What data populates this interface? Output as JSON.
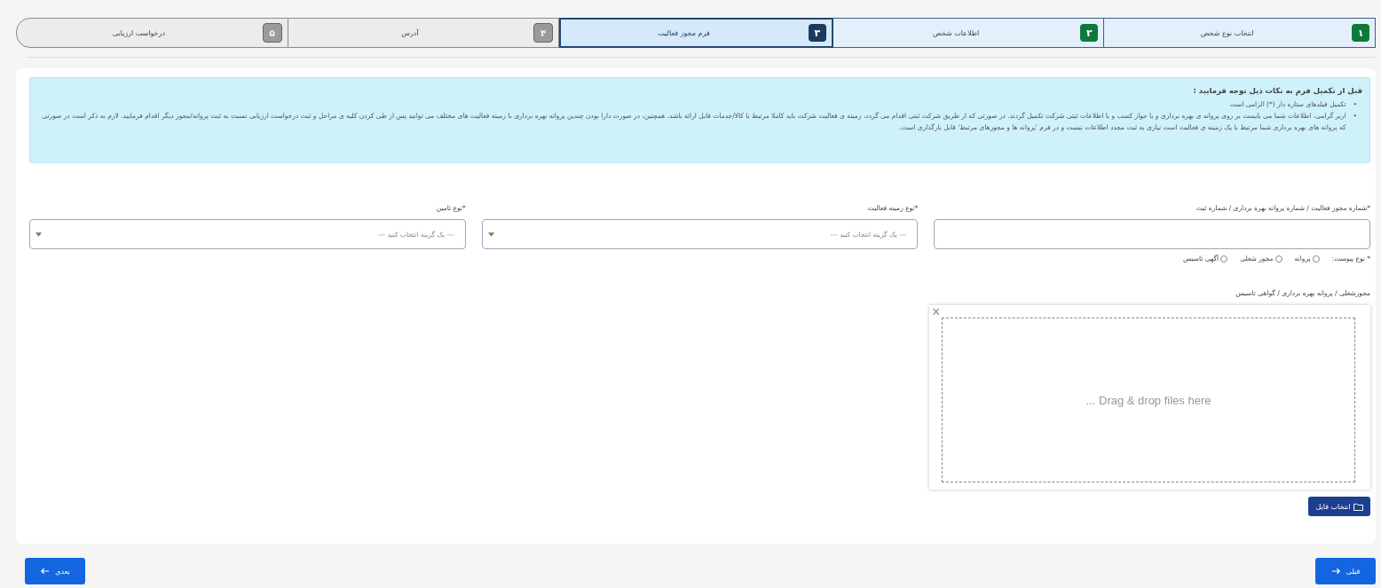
{
  "steps": [
    {
      "number": "۱",
      "label": "انتخاب نوع شخص",
      "completed": true,
      "selected": false
    },
    {
      "number": "۲",
      "label": "اطلاعات شخص",
      "completed": true,
      "selected": false
    },
    {
      "number": "۳",
      "label": "فرم مجوز فعالیت",
      "completed": false,
      "selected": true
    },
    {
      "number": "۴",
      "label": "آدرس",
      "completed": false,
      "selected": false
    },
    {
      "number": "۵",
      "label": "درخواست ارزیابی",
      "completed": false,
      "selected": false
    }
  ],
  "notice": {
    "title": "قبل از تکمیل فرم به نکات ذیل توجه فرمایید :",
    "items": [
      {
        "bullet": "•",
        "text": "تکمیل فیلدهای ستاره دار (*) الزامی است"
      },
      {
        "bullet": "•",
        "text": "اربر گرامی، اطلاعات شما می بایست بر روی پروانه ی بهره برداری و یا جواز کسب و با اطلاعات ثبتی شرکت تکمیل گردند. در صورتی که از طریق شرکت ثبتی اقدام می گردد، زمینه ی فعالیت شرکت باید کاملا مرتبط با کالا/خدمات قابل ارائه باشد. همچنین، در صورت دارا بودن چندین پروانه بهره برداری با زمینه فعالیت های مختلف می توانید پس از طی کردن کلیه ی مراحل و ثبت درخواست ارزیابی نسبت به ثبت پروانه/مجوز دیگر اقدام فرمایید. لازم به ذکر است در صورتی که پروانه های بهره برداری شما مرتبط با یک زمینه ی فعالیت است نیازی به ثبت مجدد اطلاعات نیست و در فرم 'پروانه ها و مجوزهای مرتبط' قابل بارگذاری است."
      }
    ]
  },
  "fields": [
    {
      "kind": "text",
      "label": "*شماره مجوز فعالیت / شماره پروانه بهره برداری / شماره ثبت"
    },
    {
      "kind": "select",
      "label": "*نوع زمینه فعالیت",
      "placeholder": "--- یک گزینه انتخاب کنید ---"
    },
    {
      "kind": "select",
      "label": "*نوع تامین",
      "placeholder": "--- یک گزینه انتخاب کنید ---"
    }
  ],
  "attachment_type": {
    "label": "* نوع پیوست:",
    "options": [
      {
        "label": "پروانه",
        "selected": false
      },
      {
        "label": "مجوز شغلی",
        "selected": false
      },
      {
        "label": "آگهی تاسیس",
        "selected": false
      }
    ]
  },
  "upload": {
    "label": "مجوزشغلی / پروانه بهره برداری / گواهی تاسیس",
    "drop_hint": "... Drag & drop files here",
    "close": "×",
    "button": "انتخاب فایل"
  },
  "nav": {
    "previous": "قبلی",
    "next": "بعدی"
  }
}
